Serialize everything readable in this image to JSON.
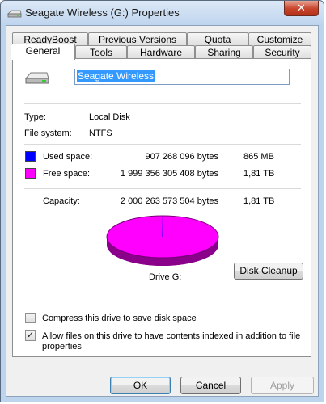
{
  "window": {
    "title": "Seagate Wireless (G:) Properties",
    "close_glyph": "✕",
    "icon": "drive-icon"
  },
  "tabs": {
    "row1": [
      "ReadyBoost",
      "Previous Versions",
      "Quota",
      "Customize"
    ],
    "row2": [
      "General",
      "Tools",
      "Hardware",
      "Sharing",
      "Security"
    ],
    "active": "General"
  },
  "general": {
    "drive_name": "Seagate Wireless",
    "type_label": "Type:",
    "type_value": "Local Disk",
    "fs_label": "File system:",
    "fs_value": "NTFS",
    "used": {
      "label": "Used space:",
      "bytes": "907 268 096 bytes",
      "short": "865 MB",
      "color": "#0000ff"
    },
    "free": {
      "label": "Free space:",
      "bytes": "1 999 356 305 408 bytes",
      "short": "1,81 TB",
      "color": "#ff00ff"
    },
    "capacity": {
      "label": "Capacity:",
      "bytes": "2 000 263 573 504 bytes",
      "short": "1,81 TB"
    },
    "drive_label": "Drive G:",
    "cleanup_button": "Disk Cleanup",
    "compress": {
      "label": "Compress this drive to save disk space",
      "checked": false
    },
    "index": {
      "label": "Allow files on this drive to have contents indexed in addition to file properties",
      "checked": true
    },
    "check_glyph": "✓"
  },
  "footer": {
    "ok": "OK",
    "cancel": "Cancel",
    "apply": "Apply"
  }
}
